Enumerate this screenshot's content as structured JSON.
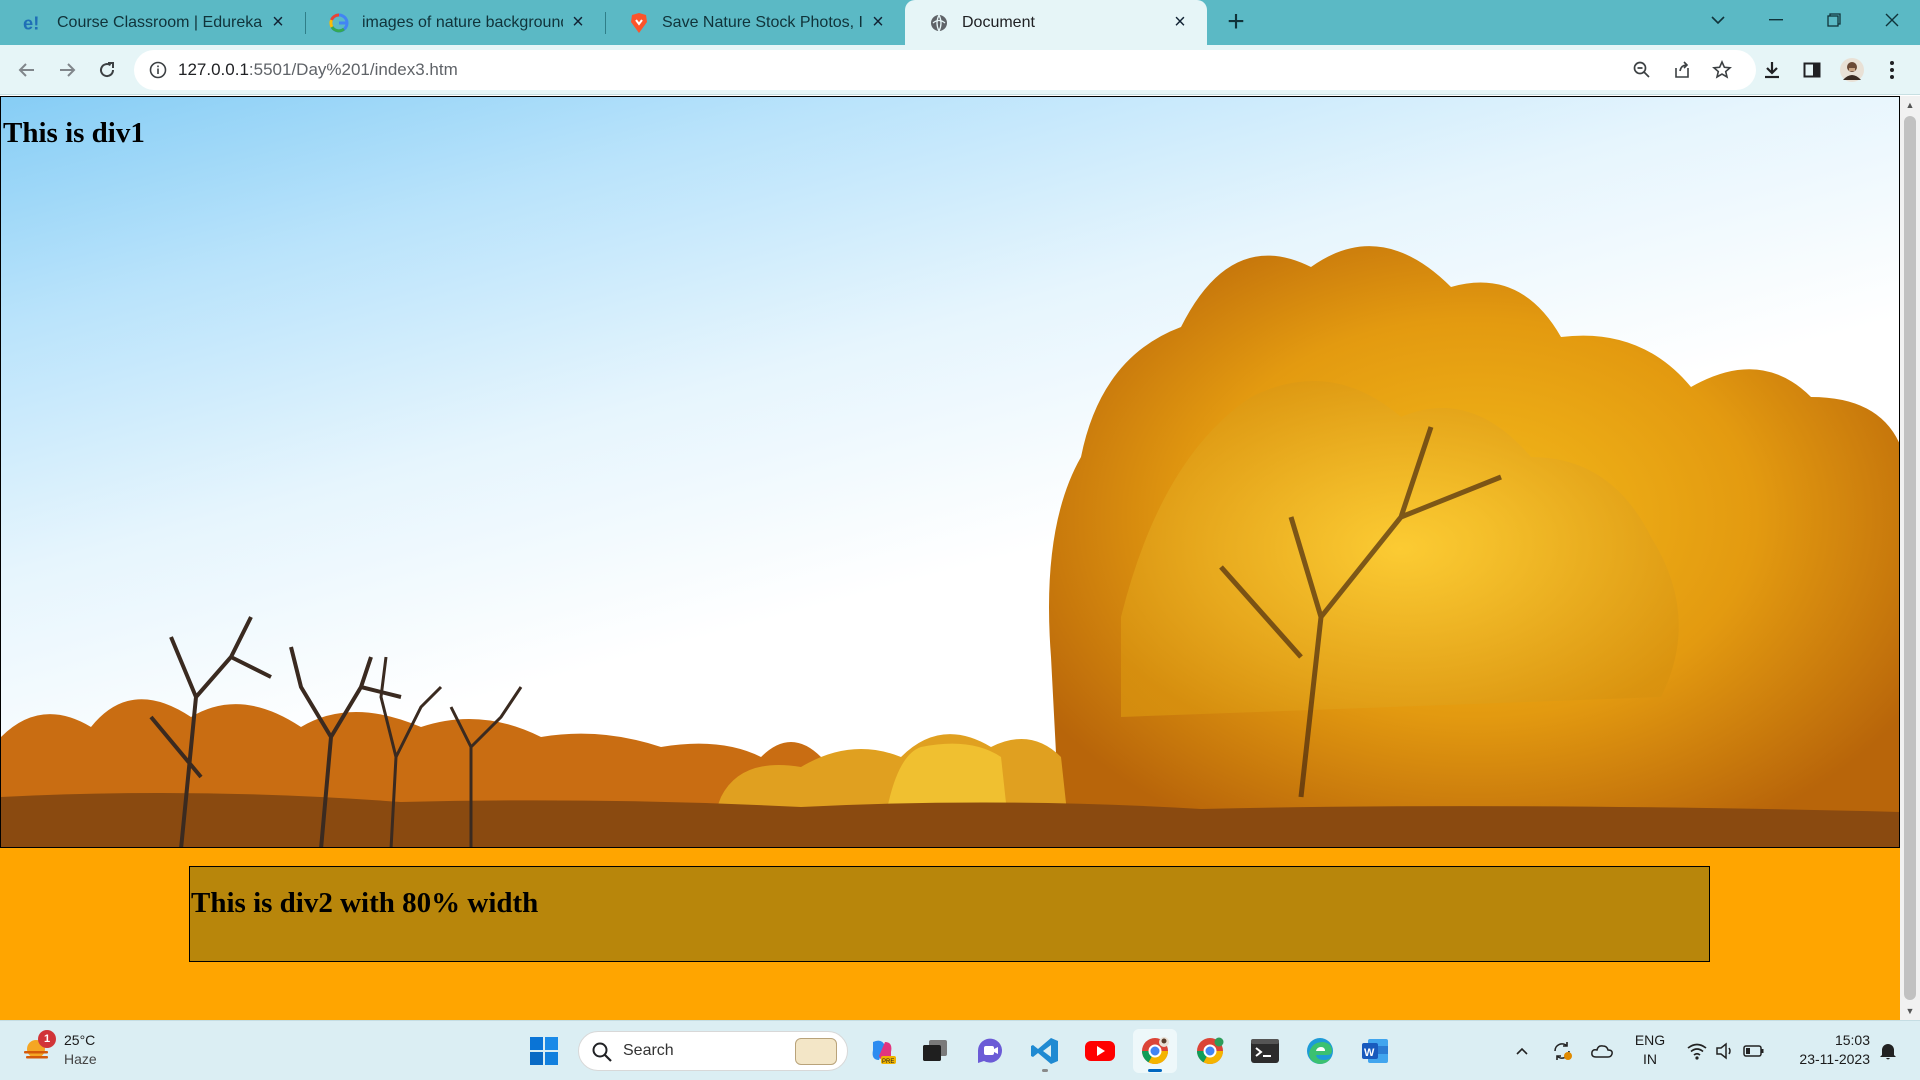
{
  "browser": {
    "tabs": [
      {
        "title": "Course Classroom | Edureka",
        "favicon": "edureka-icon"
      },
      {
        "title": "images of nature background hd",
        "favicon": "google-icon"
      },
      {
        "title": "Save Nature Stock Photos, Imag",
        "favicon": "brave-icon"
      },
      {
        "title": "Document",
        "favicon": "globe-icon",
        "active": true
      }
    ],
    "url_host": "127.0.0.1",
    "url_path": ":5501/Day%201/index3.htm"
  },
  "page": {
    "div1_heading": "This is div1",
    "div2_heading": "This is div2 with 80% width",
    "colors": {
      "body_bg": "#ffa500",
      "div2_bg": "#b8860b",
      "border": "#000000"
    }
  },
  "taskbar": {
    "weather": {
      "badge": "1",
      "temp": "25°C",
      "condition": "Haze"
    },
    "search_label": "Search",
    "pinned": [
      "copilot-icon",
      "task-view-icon",
      "teams-chat-icon",
      "vscode-icon",
      "youtube-icon",
      "chrome-profile-icon",
      "chrome-icon",
      "terminal-icon",
      "edge-icon",
      "word-icon"
    ],
    "lang_line1": "ENG",
    "lang_line2": "IN",
    "time": "15:03",
    "date": "23-11-2023"
  }
}
